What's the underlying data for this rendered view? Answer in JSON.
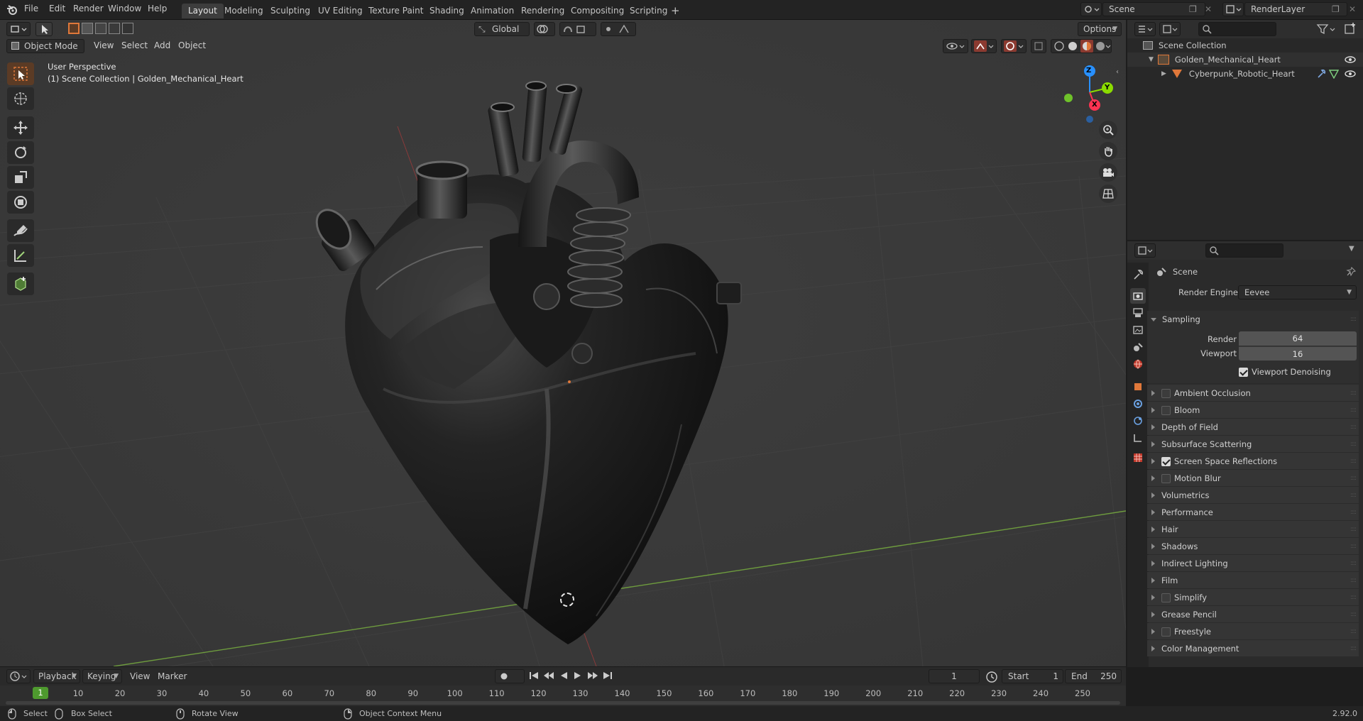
{
  "topbar": {
    "menus": [
      "File",
      "Edit",
      "Render",
      "Window",
      "Help"
    ],
    "workspaces": [
      "Layout",
      "Modeling",
      "Sculpting",
      "UV Editing",
      "Texture Paint",
      "Shading",
      "Animation",
      "Rendering",
      "Compositing",
      "Scripting"
    ],
    "active_workspace": "Layout",
    "add_tab": "+",
    "scene_name": "Scene",
    "view_layer": "RenderLayer"
  },
  "viewport": {
    "mode": "Object Mode",
    "menus": [
      "View",
      "Select",
      "Add",
      "Object"
    ],
    "transform_orientation": "Global",
    "options_label": "Options",
    "overlay_text_1": "User Perspective",
    "overlay_text_2": "(1) Scene Collection | Golden_Mechanical_Heart",
    "gizmo": {
      "x": "X",
      "y": "Y",
      "z": "Z"
    },
    "tools": [
      "select-box-tool",
      "cursor-tool",
      "move-tool",
      "rotate-tool",
      "scale-tool",
      "transform-tool",
      "annotate-tool",
      "measure-tool",
      "add-cube-tool"
    ]
  },
  "outliner": {
    "root": "Scene Collection",
    "items": [
      {
        "label": "Golden_Mechanical_Heart",
        "level": 1
      },
      {
        "label": "Cyberpunk_Robotic_Heart",
        "level": 2
      }
    ]
  },
  "properties": {
    "context": "Scene",
    "render_engine_label": "Render Engine",
    "render_engine_value": "Eevee",
    "sampling_label": "Sampling",
    "render_label": "Render",
    "render_value": "64",
    "viewport_label": "Viewport",
    "viewport_value": "16",
    "viewport_denoising_label": "Viewport Denoising",
    "viewport_denoising": true,
    "sections": [
      {
        "label": "Ambient Occlusion",
        "checkbox": true,
        "checked": false
      },
      {
        "label": "Bloom",
        "checkbox": true,
        "checked": false
      },
      {
        "label": "Depth of Field",
        "checkbox": false
      },
      {
        "label": "Subsurface Scattering",
        "checkbox": false
      },
      {
        "label": "Screen Space Reflections",
        "checkbox": true,
        "checked": true
      },
      {
        "label": "Motion Blur",
        "checkbox": true,
        "checked": false
      },
      {
        "label": "Volumetrics",
        "checkbox": false
      },
      {
        "label": "Performance",
        "checkbox": false
      },
      {
        "label": "Hair",
        "checkbox": false
      },
      {
        "label": "Shadows",
        "checkbox": false
      },
      {
        "label": "Indirect Lighting",
        "checkbox": false
      },
      {
        "label": "Film",
        "checkbox": false
      },
      {
        "label": "Simplify",
        "checkbox": true,
        "checked": false
      },
      {
        "label": "Grease Pencil",
        "checkbox": false
      },
      {
        "label": "Freestyle",
        "checkbox": true,
        "checked": false
      },
      {
        "label": "Color Management",
        "checkbox": false
      }
    ]
  },
  "timeline": {
    "menus": [
      "Playback",
      "Keying",
      "View",
      "Marker"
    ],
    "current_frame": "1",
    "start_label": "Start",
    "start_value": "1",
    "end_label": "End",
    "end_value": "250",
    "ruler_current": "1",
    "ruler_ticks": [
      "10",
      "20",
      "30",
      "40",
      "50",
      "60",
      "70",
      "80",
      "90",
      "100",
      "110",
      "120",
      "130",
      "140",
      "150",
      "160",
      "170",
      "180",
      "190",
      "200",
      "210",
      "220",
      "230",
      "240",
      "250"
    ]
  },
  "statusbar": {
    "select": "Select",
    "box_select": "Box Select",
    "rotate_view": "Rotate View",
    "context_menu": "Object Context Menu",
    "version": "2.92.0"
  },
  "colors": {
    "accent_orange": "#e0783a",
    "active_tab": "#3d3d3d",
    "frame_green": "#4e9a2e",
    "axis_x": "#ff3352",
    "axis_y": "#8bdc00",
    "axis_z": "#2890ff"
  }
}
